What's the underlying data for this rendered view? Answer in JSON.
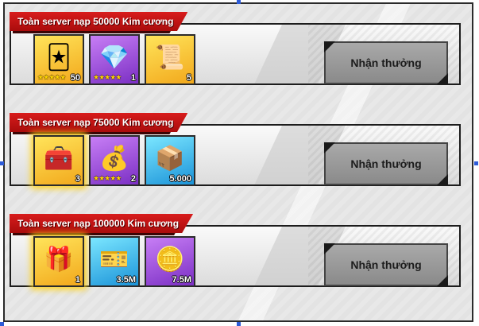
{
  "panels": [
    {
      "title": "Toàn server nạp 50000 Kim cương",
      "button_label": "Nhận thưởng",
      "items": [
        {
          "icon": "cards-pack-icon",
          "quantity": "50",
          "stars": "★★★★★"
        },
        {
          "icon": "treasure-box-icon",
          "quantity": "1",
          "stars": "★★★★★"
        },
        {
          "icon": "wanted-poster-icon",
          "quantity": "5",
          "stars": ""
        }
      ]
    },
    {
      "title": "Toàn server nạp 75000 Kim cương",
      "button_label": "Nhận thưởng",
      "items": [
        {
          "icon": "green-chest-icon",
          "quantity": "3",
          "stars": ""
        },
        {
          "icon": "treasure-box-icon",
          "quantity": "2",
          "stars": "★★★★★"
        },
        {
          "icon": "crate-icon",
          "quantity": "5.000",
          "stars": ""
        }
      ]
    },
    {
      "title": "Toàn server nạp 100000 Kim cương",
      "button_label": "Nhận thưởng",
      "items": [
        {
          "icon": "purple-chest-icon",
          "quantity": "1",
          "stars": ""
        },
        {
          "icon": "exp-ticket-icon",
          "quantity": "3.5M",
          "stars": ""
        },
        {
          "icon": "gold-coin-icon",
          "quantity": "7.5M",
          "stars": ""
        }
      ]
    }
  ]
}
